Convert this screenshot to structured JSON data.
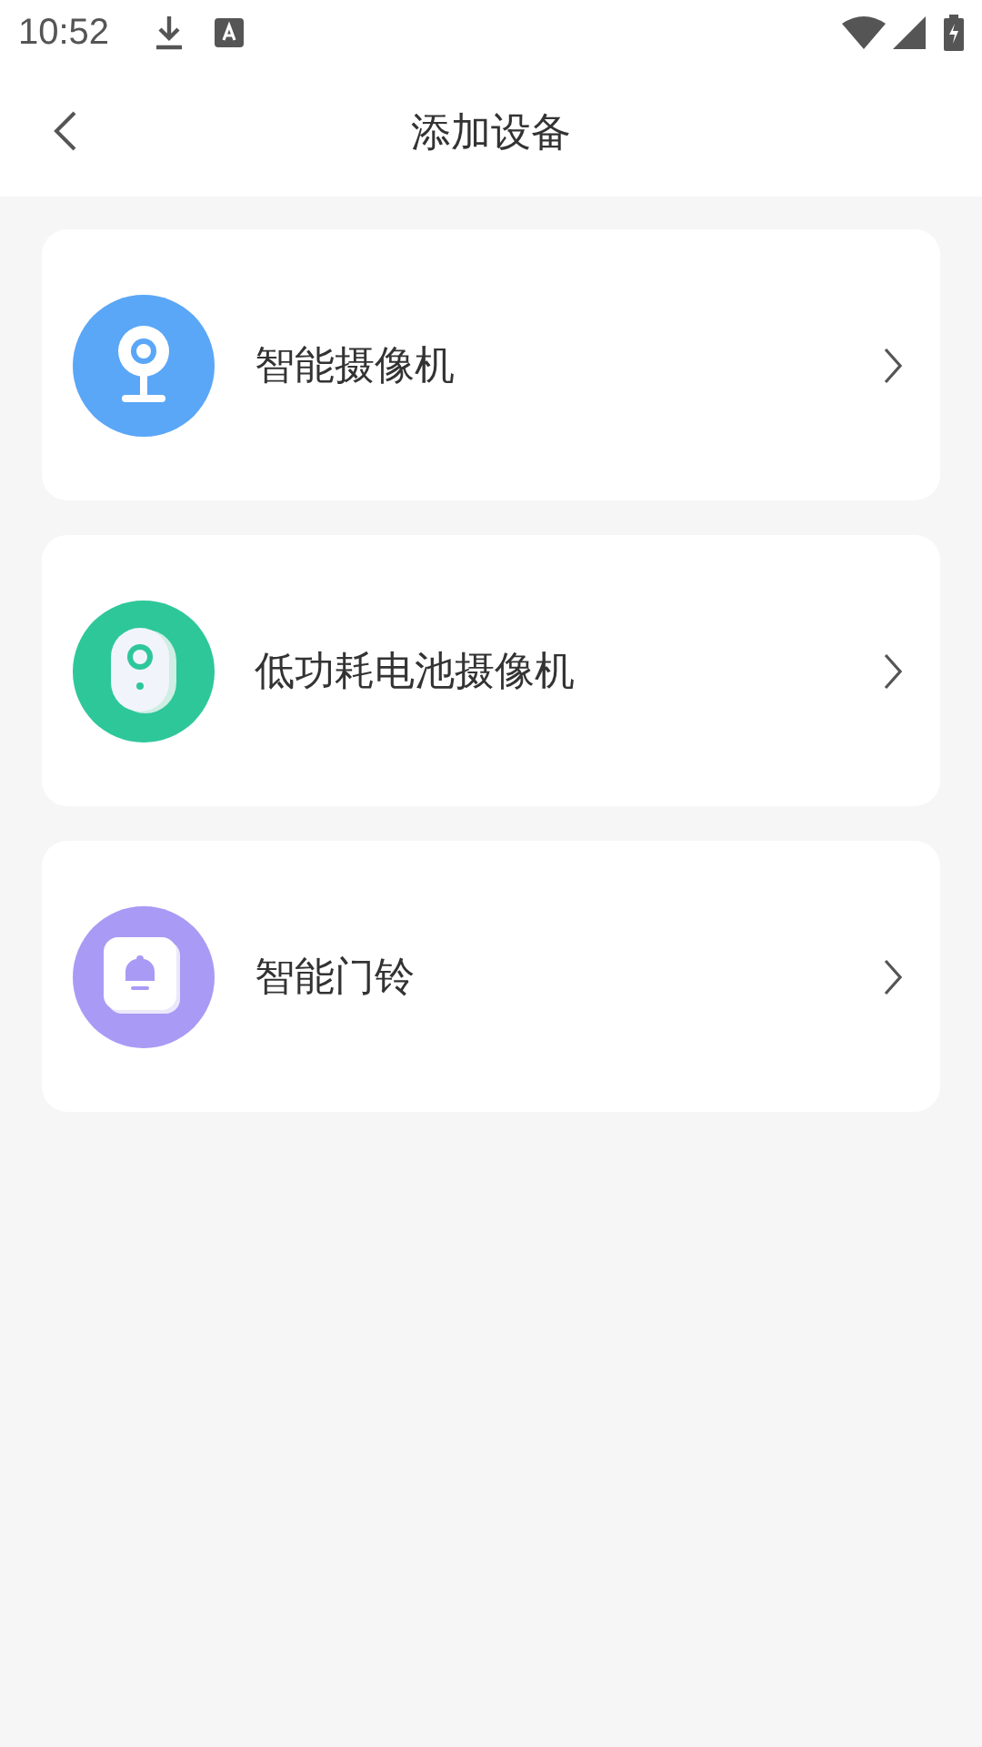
{
  "status_bar": {
    "time": "10:52"
  },
  "header": {
    "title": "添加设备"
  },
  "devices": [
    {
      "kind": "camera",
      "label": "智能摄像机",
      "color": "#5aa6f7"
    },
    {
      "kind": "battery-camera",
      "label": "低功耗电池摄像机",
      "color": "#2ec79a"
    },
    {
      "kind": "doorbell",
      "label": "智能门铃",
      "color": "#a99af5"
    }
  ]
}
